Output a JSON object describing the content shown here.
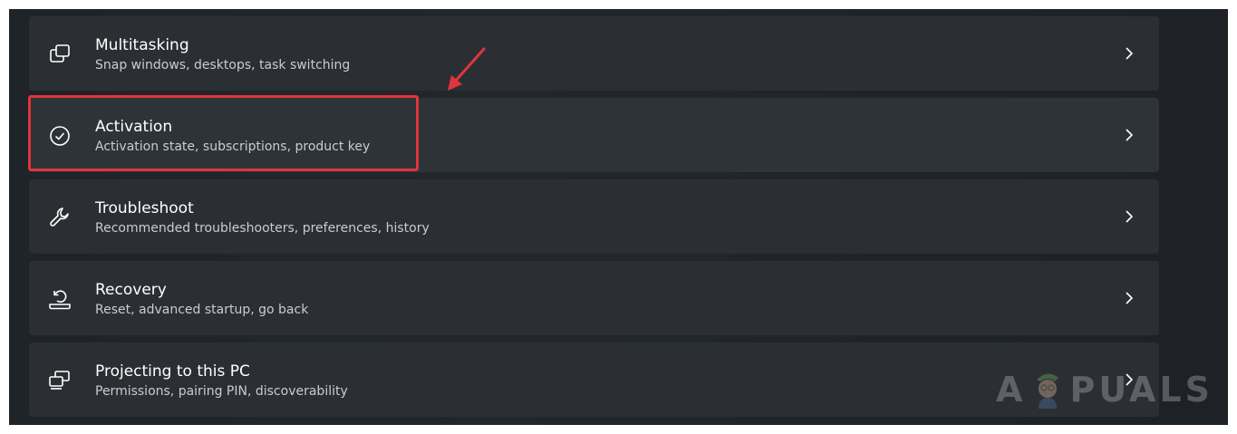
{
  "settings": {
    "items": [
      {
        "title": "Multitasking",
        "subtitle": "Snap windows, desktops, task switching",
        "icon": "multitasking-icon"
      },
      {
        "title": "Activation",
        "subtitle": "Activation state, subscriptions, product key",
        "icon": "activation-check-icon"
      },
      {
        "title": "Troubleshoot",
        "subtitle": "Recommended troubleshooters, preferences, history",
        "icon": "wrench-icon"
      },
      {
        "title": "Recovery",
        "subtitle": "Reset, advanced startup, go back",
        "icon": "recovery-icon"
      },
      {
        "title": "Projecting to this PC",
        "subtitle": "Permissions, pairing PIN, discoverability",
        "icon": "projecting-icon"
      }
    ]
  },
  "annotation": {
    "highlighted_item": "Activation",
    "color": "#e0353c"
  },
  "watermark": {
    "text_left": "A",
    "text_right": "PUALS"
  },
  "colors": {
    "background": "#202428",
    "card": "#2b2f34",
    "title_text": "#ffffff",
    "subtitle_text": "#c9ccd0"
  }
}
